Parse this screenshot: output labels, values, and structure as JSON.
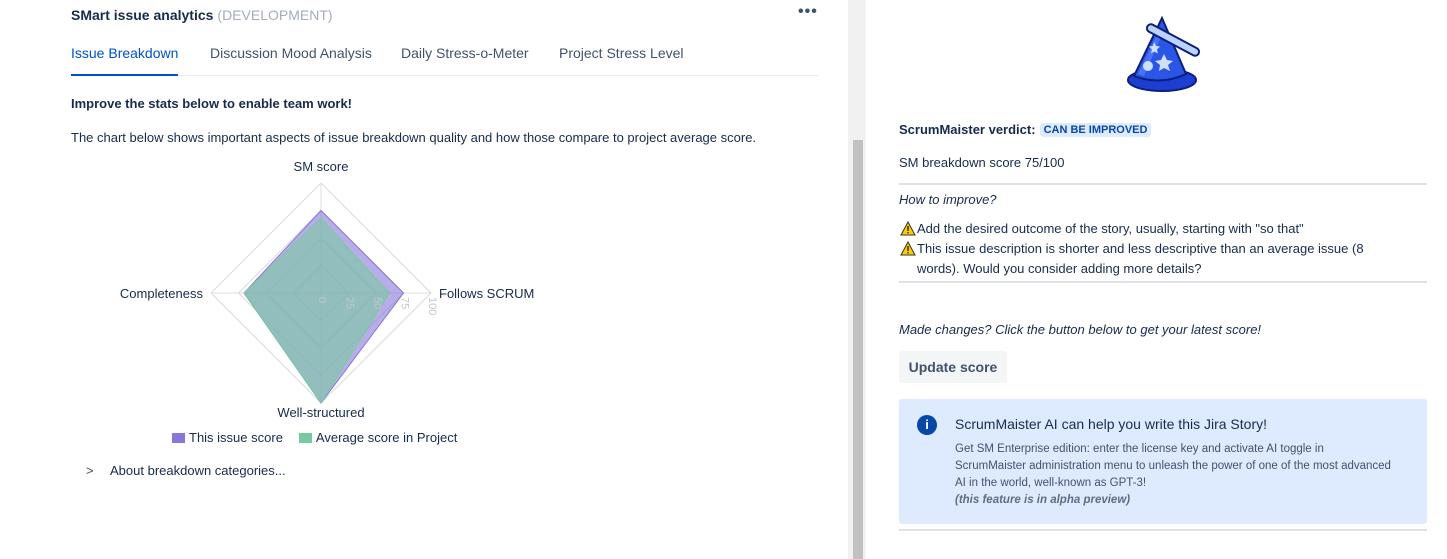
{
  "header": {
    "title": "SMart issue analytics",
    "env": "(DEVELOPMENT)",
    "more_label": "•••"
  },
  "tabs": [
    {
      "label": "Issue Breakdown",
      "active": true
    },
    {
      "label": "Discussion Mood Analysis",
      "active": false
    },
    {
      "label": "Daily Stress-o-Meter",
      "active": false
    },
    {
      "label": "Project Stress Level",
      "active": false
    }
  ],
  "content": {
    "improve_text": "Improve the stats below to enable team work!",
    "description": "The chart below shows important aspects of issue breakdown quality and how those compare to project average score."
  },
  "chart_data": {
    "type": "radar",
    "axes": [
      "SM score",
      "Follows SCRUM",
      "Well-structured",
      "Completeness"
    ],
    "ticks": [
      "0",
      "25",
      "50",
      "75",
      "100"
    ],
    "range": [
      0,
      100
    ],
    "series": [
      {
        "name": "This issue score",
        "values": [
          75,
          75,
          100,
          70
        ],
        "color": "#8777d9"
      },
      {
        "name": "Average score in Project",
        "values": [
          68,
          62,
          100,
          70
        ],
        "color": "#79c9a0"
      }
    ]
  },
  "about": {
    "chevron": ">",
    "label": "About breakdown categories..."
  },
  "verdict": {
    "label": "ScrumMaister verdict:",
    "badge": "CAN BE IMPROVED",
    "score_text": "SM breakdown score 75/100"
  },
  "improve": {
    "heading": "How to improve?",
    "items": [
      "Add the desired outcome of the story, usually, starting with \"so that\"",
      "This issue description is shorter and less descriptive than an average issue (8 words). Would you consider adding more details?"
    ]
  },
  "update": {
    "prompt": "Made changes? Click the button below to get your latest score!",
    "button_label": "Update score"
  },
  "info": {
    "icon": "i",
    "title": "ScrumMaister AI can help you write this Jira Story!",
    "body": "Get SM Enterprise edition: enter the license key and activate AI toggle in ScrumMaister administration menu to unleash the power of one of the most advanced AI in the world, well-known as GPT-3!",
    "note": "(this feature is in alpha preview)"
  },
  "colors": {
    "accent": "#0052cc",
    "badge_bg": "#deebff",
    "info_bg": "#deebff",
    "warning": "#ffab00"
  }
}
